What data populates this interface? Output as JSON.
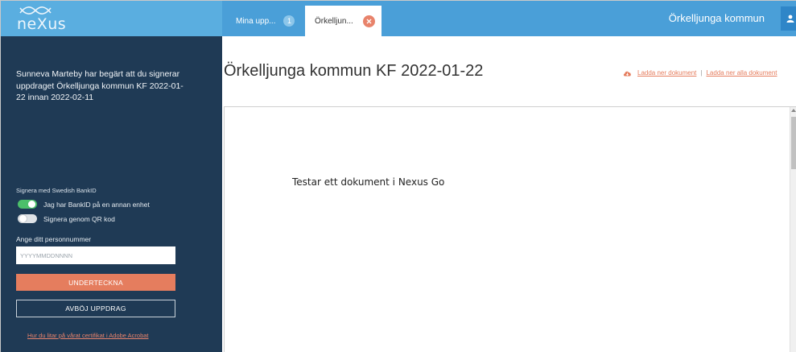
{
  "app": {
    "logo_text": "neXus",
    "org_name": "Örkelljunga kommun"
  },
  "tabs": [
    {
      "label": "Mina upp...",
      "badge": "1"
    },
    {
      "label": "Örkelljun..."
    }
  ],
  "sidebar": {
    "message": "Sunneva Marteby har begärt att du signerar uppdraget Örkelljunga kommun KF 2022-01-22 innan 2022-02-11",
    "sign_method_label": "Signera med Swedish BankID",
    "options": [
      {
        "label": "Jag har BankID på en annan enhet",
        "enabled": true
      },
      {
        "label": "Signera genom QR kod",
        "enabled": false
      }
    ],
    "personnummer_label": "Ange ditt personnummer",
    "personnummer_placeholder": "YYYYMMDDNNNN",
    "sign_button": "UNDERTECKNA",
    "decline_button": "AVBÖJ UPPDRAG",
    "cert_link": "Hur du litar på vårat certifikat i Adobe Acrobat"
  },
  "main": {
    "title": "Örkelljunga kommun KF 2022-01-22",
    "download_doc": "Ladda ner dokument",
    "separator": "|",
    "download_all": "Ladda ner alla dokument",
    "document_text": "Testar ett dokument i Nexus Go"
  },
  "colors": {
    "topbar": "#4a9fd8",
    "sidebar": "#1f3a55",
    "accent": "#e57d5e",
    "toggle_on": "#4cbf6a"
  }
}
